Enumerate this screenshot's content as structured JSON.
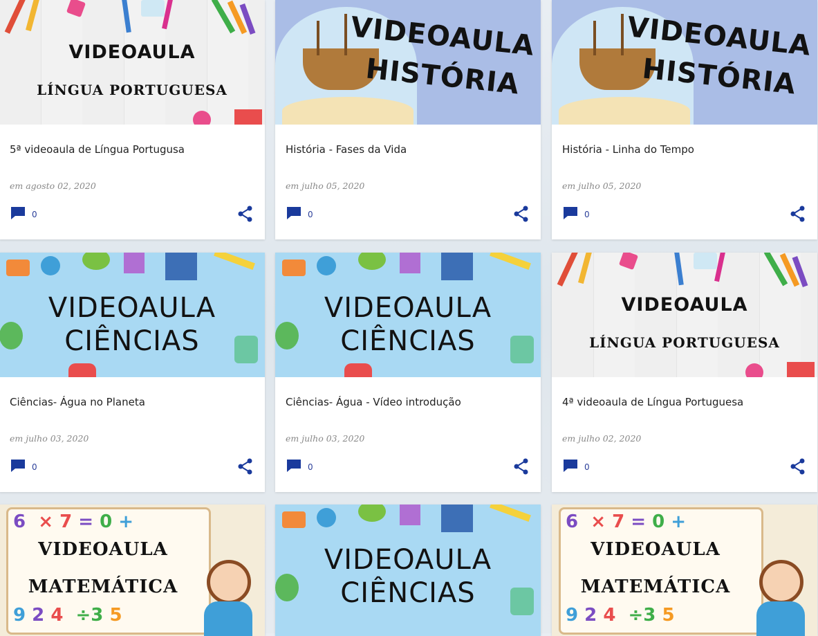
{
  "colors": {
    "accent": "#1a3a9c",
    "date": "#888888",
    "title": "#222222"
  },
  "icons": {
    "comment": "comment-icon",
    "share": "share-icon"
  },
  "posts": [
    {
      "thumb_line1": "VIDEOAULA",
      "thumb_line2": "LÍNGUA PORTUGUESA",
      "title": "5ª videoaula de Língua Portugusa",
      "date": "em agosto 02, 2020",
      "comments": "0"
    },
    {
      "thumb_line1": "VIDEOAULA",
      "thumb_line2": "HISTÓRIA",
      "title": "História - Fases da Vida",
      "date": "em julho 05, 2020",
      "comments": "0"
    },
    {
      "thumb_line1": "VIDEOAULA",
      "thumb_line2": "HISTÓRIA",
      "title": "História - Linha do Tempo",
      "date": "em julho 05, 2020",
      "comments": "0"
    },
    {
      "thumb_line1": "VIDEOAULA",
      "thumb_line2": "CIÊNCIAS",
      "title": "Ciências- Água no Planeta",
      "date": "em julho 03, 2020",
      "comments": "0"
    },
    {
      "thumb_line1": "VIDEOAULA",
      "thumb_line2": "CIÊNCIAS",
      "title": "Ciências- Água - Vídeo introdução",
      "date": "em julho 03, 2020",
      "comments": "0"
    },
    {
      "thumb_line1": "VIDEOAULA",
      "thumb_line2": "LÍNGUA PORTUGUESA",
      "title": "4ª videoaula de Língua Portuguesa",
      "date": "em julho 02, 2020",
      "comments": "0"
    },
    {
      "thumb_line1": "VIDEOAULA",
      "thumb_line2": "MATEMÁTICA"
    },
    {
      "thumb_line1": "VIDEOAULA",
      "thumb_line2": "CIÊNCIAS"
    },
    {
      "thumb_line1": "VIDEOAULA",
      "thumb_line2": "MATEMÁTICA"
    }
  ]
}
